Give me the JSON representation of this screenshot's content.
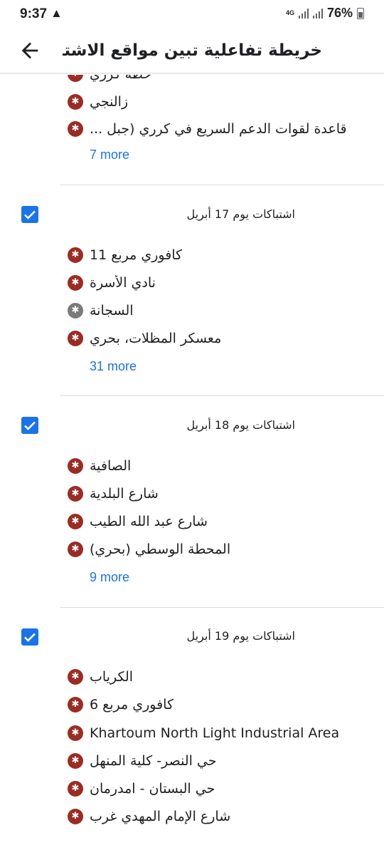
{
  "status": {
    "time": "9:37",
    "network": "4G",
    "battery": "76%"
  },
  "header": {
    "title": "خريطة تفاعلية تبين مواقع الاشتباكا..."
  },
  "group0": {
    "items": [
      {
        "label": "حطة كرري",
        "pin": "red"
      },
      {
        "label": "زالنجي",
        "pin": "red"
      },
      {
        "label": "قاعدة لقوات الدعم السريع في كرري (جبل ...",
        "pin": "red"
      }
    ],
    "more": "7 more"
  },
  "groups": [
    {
      "title": "اشتباكات يوم 17 أبريل",
      "items": [
        {
          "label": "كافوري مربع 11",
          "pin": "red"
        },
        {
          "label": "نادي الأسرة",
          "pin": "red"
        },
        {
          "label": "السجانة",
          "pin": "gray"
        },
        {
          "label": "معسكر المظلات، بحري",
          "pin": "red"
        }
      ],
      "more": "31 more"
    },
    {
      "title": "اشتباكات يوم 18 أبريل",
      "items": [
        {
          "label": "الصافية",
          "pin": "red"
        },
        {
          "label": "شارع البلدية",
          "pin": "red"
        },
        {
          "label": "شارع عبد الله الطيب",
          "pin": "red"
        },
        {
          "label": "المحطة الوسطي (بحري)",
          "pin": "red"
        }
      ],
      "more": "9 more"
    },
    {
      "title": "اشتباكات يوم 19 أبريل",
      "items": [
        {
          "label": "الكرياب",
          "pin": "red"
        },
        {
          "label": "كافوري مربع 6",
          "pin": "red"
        },
        {
          "label": "Khartoum North Light Industrial Area",
          "pin": "red"
        },
        {
          "label": "حي النصر- كلية المنهل",
          "pin": "red"
        },
        {
          "label": "حي البستان - امدرمان",
          "pin": "red"
        },
        {
          "label": "شارع الإمام المهدي غرب",
          "pin": "red"
        }
      ]
    }
  ]
}
